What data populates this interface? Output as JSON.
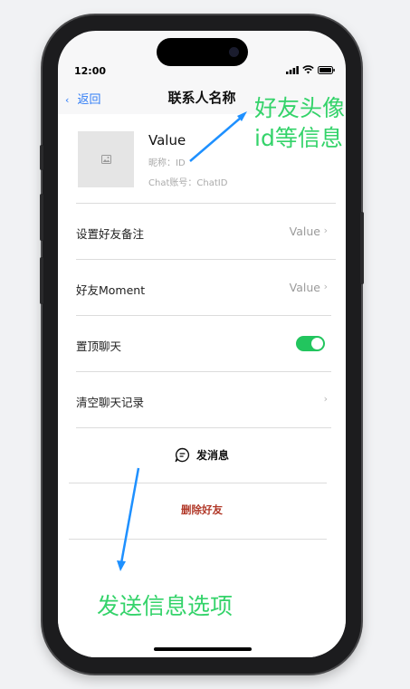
{
  "status": {
    "time": "12:00"
  },
  "nav": {
    "back_label": "返回",
    "title": "联系人名称"
  },
  "profile": {
    "name": "Value",
    "nickname_label": "昵称：",
    "nickname_value": "ID",
    "chat_id_label": "Chat账号：",
    "chat_id_value": "ChatID"
  },
  "rows": [
    {
      "label": "设置好友备注",
      "value": "Value"
    },
    {
      "label": "好友Moment",
      "value": "Value"
    },
    {
      "label": "置顶聊天",
      "toggle": true
    },
    {
      "label": "清空聊天记录"
    }
  ],
  "actions": {
    "send_label": "发消息",
    "delete_label": "删除好友"
  },
  "annotations": {
    "avatar_note_line1": "好友头像",
    "avatar_note_line2": "id等信息",
    "send_note": "发送信息选项"
  },
  "colors": {
    "accent_blue": "#2f7cf6",
    "toggle_green": "#22c55e",
    "danger_red": "#b23a2a",
    "annotation_green": "#34d36a",
    "arrow_blue": "#1e90ff"
  }
}
